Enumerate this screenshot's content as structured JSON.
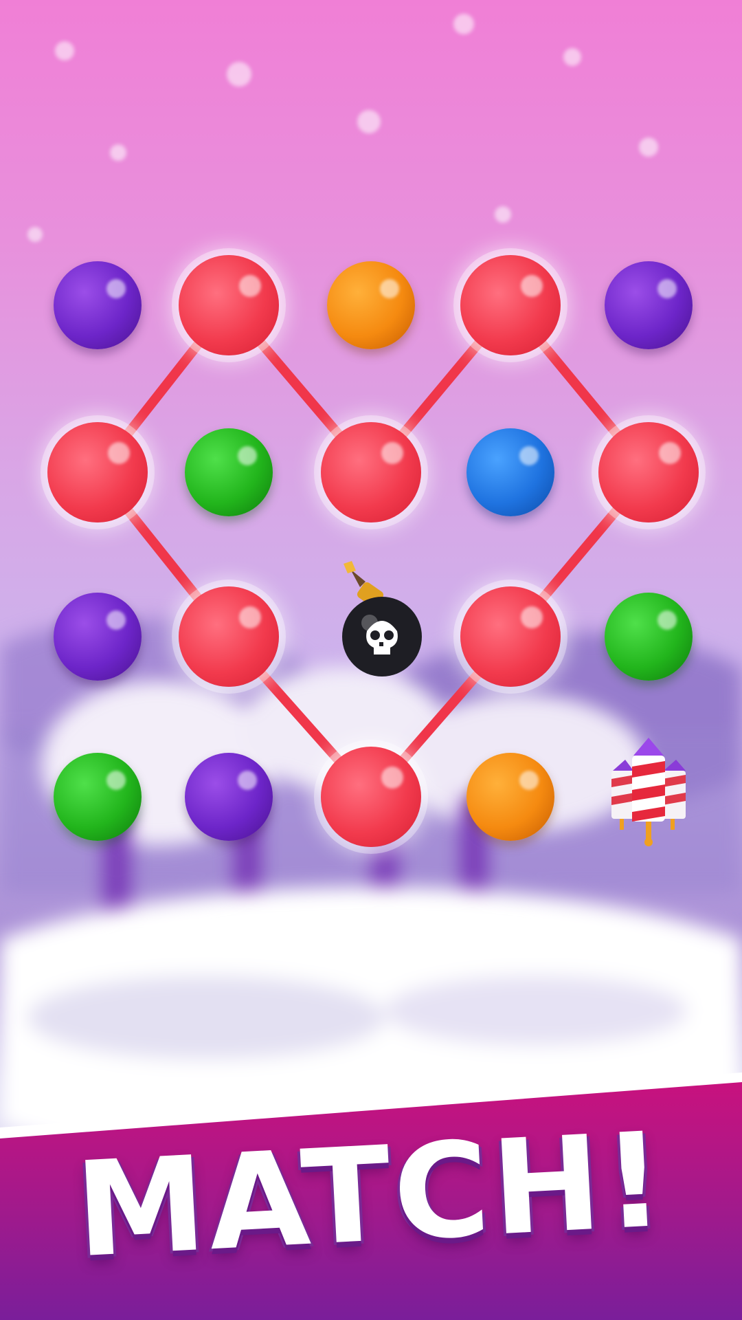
{
  "banner": {
    "title": "MATCH!"
  },
  "colors": {
    "red": "#f23a4d",
    "purple": "#6d25c9",
    "orange": "#f58a10",
    "green": "#22b51c",
    "blue": "#1f73e0",
    "banner_top": "#c8127e",
    "banner_bottom": "#7a1e9a"
  },
  "board": {
    "rows": [
      [
        "purple",
        "red",
        "orange",
        "red",
        "purple"
      ],
      [
        "red",
        "green",
        "red",
        "blue",
        "red"
      ],
      [
        "purple",
        "red",
        "bomb",
        "red",
        "green"
      ],
      [
        "green",
        "purple",
        "red",
        "orange",
        "rocket"
      ]
    ],
    "chain": [
      [
        1,
        0
      ],
      [
        0,
        1
      ],
      [
        1,
        2
      ],
      [
        0,
        3
      ],
      [
        1,
        4
      ],
      [
        2,
        3
      ],
      [
        3,
        2
      ],
      [
        2,
        1
      ],
      [
        1,
        0
      ]
    ],
    "special_icons": {
      "bomb": "skull-bomb-icon",
      "rocket": "firework-rocket-icon"
    }
  }
}
